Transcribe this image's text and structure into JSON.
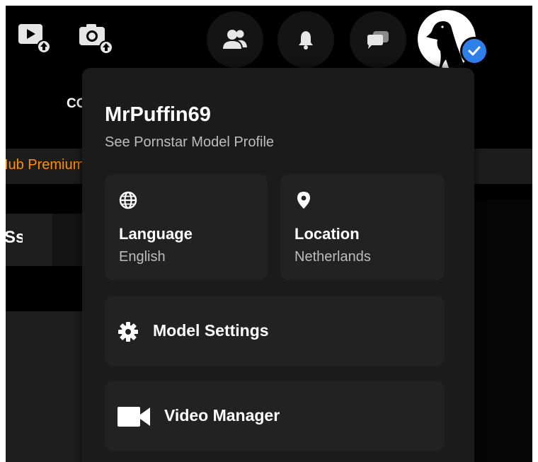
{
  "header": {
    "icons": {
      "upload_video": "video-upload-icon",
      "upload_photo": "photo-upload-icon",
      "friends": "friends-icon",
      "notifications": "bell-icon",
      "messages": "chat-icon",
      "avatar": "puffin-avatar",
      "verified": "verified-check-icon"
    }
  },
  "background": {
    "nav_fragment": "CO",
    "premium_fragment": "Hub Premium",
    "section_fragment": "Ss"
  },
  "dropdown": {
    "username": "MrPuffin69",
    "profile_link": "See Pornstar Model Profile",
    "language": {
      "title": "Language",
      "value": "English",
      "icon": "globe-icon"
    },
    "location": {
      "title": "Location",
      "value": "Netherlands",
      "icon": "map-pin-icon"
    },
    "model_settings": {
      "label": "Model Settings",
      "icon": "gear-icon"
    },
    "video_manager": {
      "label": "Video Manager",
      "icon": "video-camera-icon"
    }
  },
  "colors": {
    "background": "#000000",
    "menu_bg": "#1b1b1b",
    "tile_bg": "#222222",
    "accent_orange": "#ff9000",
    "verified_blue": "#2f7fea",
    "secondary_text": "#bdbdbd"
  }
}
